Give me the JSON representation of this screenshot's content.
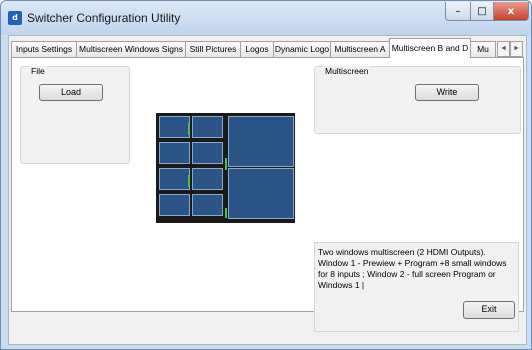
{
  "window": {
    "title": "Switcher Configuration Utility",
    "app_icon_text": "d",
    "controls": {
      "minimize": "–",
      "maximize": "□",
      "close": "x"
    }
  },
  "tabs": [
    {
      "label": "Inputs Settings",
      "active": false
    },
    {
      "label": "Multiscreen Windows Signs",
      "active": false
    },
    {
      "label": "Still Pictures",
      "active": false
    },
    {
      "label": "Logos",
      "active": false
    },
    {
      "label": "Dynamic Logo",
      "active": false
    },
    {
      "label": "Multiscreen A",
      "active": false
    },
    {
      "label": "Multiscreen B and D",
      "active": true
    },
    {
      "label": "Mu",
      "active": false
    }
  ],
  "tab_scroll": {
    "left": "◄",
    "right": "►"
  },
  "file_group": {
    "label": "File",
    "load_button": "Load"
  },
  "multiscreen_group": {
    "label": "Multiscreen",
    "write_button": "Write"
  },
  "description_text": "Two windows multiscreen  (2 HDMI Outputs).  Window 1 - Prewiew + Program +8 small windows for 8 inputs ; Window 2 - full screen Program  or Windows 1 |",
  "exit_button": "Exit",
  "colors": {
    "preview_bg": "#1a1a1a",
    "cell_fill": "#2a5586",
    "accent_green": "#4fbf4f"
  }
}
